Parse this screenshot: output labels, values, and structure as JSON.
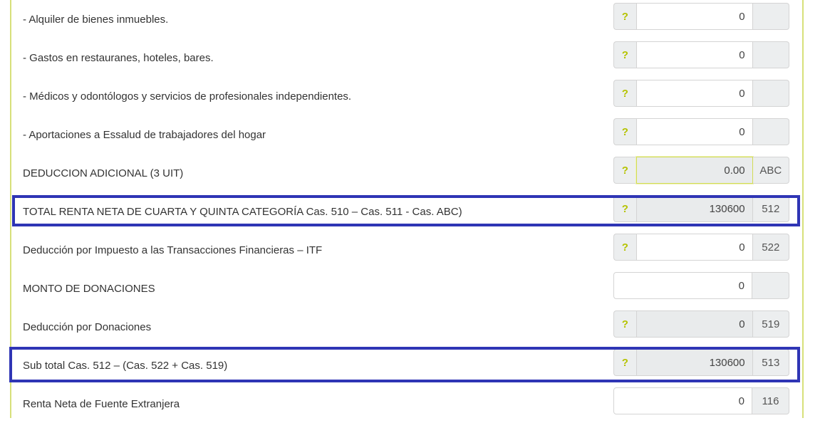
{
  "rows": [
    {
      "label": "- Alquiler de bienes inmuebles.",
      "help": "?",
      "value": "0",
      "addon": ""
    },
    {
      "label": "- Gastos en restauranes, hoteles, bares.",
      "help": "?",
      "value": "0",
      "addon": ""
    },
    {
      "label": "- Médicos y odontólogos y servicios de profesionales independientes.",
      "help": "?",
      "value": "0",
      "addon": ""
    },
    {
      "label": "- Aportaciones a Essalud de trabajadores del hogar",
      "help": "?",
      "value": "0",
      "addon": ""
    },
    {
      "label": "DEDUCCION ADICIONAL (3 UIT)",
      "help": "?",
      "value": "0.00",
      "addon": "ABC"
    },
    {
      "label": "TOTAL RENTA NETA DE CUARTA Y QUINTA CATEGORÍA Cas. 510 – Cas. 511 - Cas. ABC)",
      "help": "?",
      "value": "130600",
      "addon": "512"
    },
    {
      "label": "Deducción por Impuesto a las Transacciones Financieras – ITF",
      "help": "?",
      "value": "0",
      "addon": "522"
    },
    {
      "label": "MONTO DE DONACIONES",
      "help": "",
      "value": "0",
      "addon": ""
    },
    {
      "label": "Deducción por Donaciones",
      "help": "?",
      "value": "0",
      "addon": "519"
    },
    {
      "label": "Sub total Cas. 512 – (Cas. 522 + Cas. 519)",
      "help": "?",
      "value": "130600",
      "addon": "513"
    },
    {
      "label": "Renta Neta de Fuente Extranjera",
      "help": "",
      "value": "0",
      "addon": "116"
    }
  ],
  "colors": {
    "accent": "#b5c300",
    "highlight": "#2f35b5",
    "border_accent": "#d7e07a"
  }
}
